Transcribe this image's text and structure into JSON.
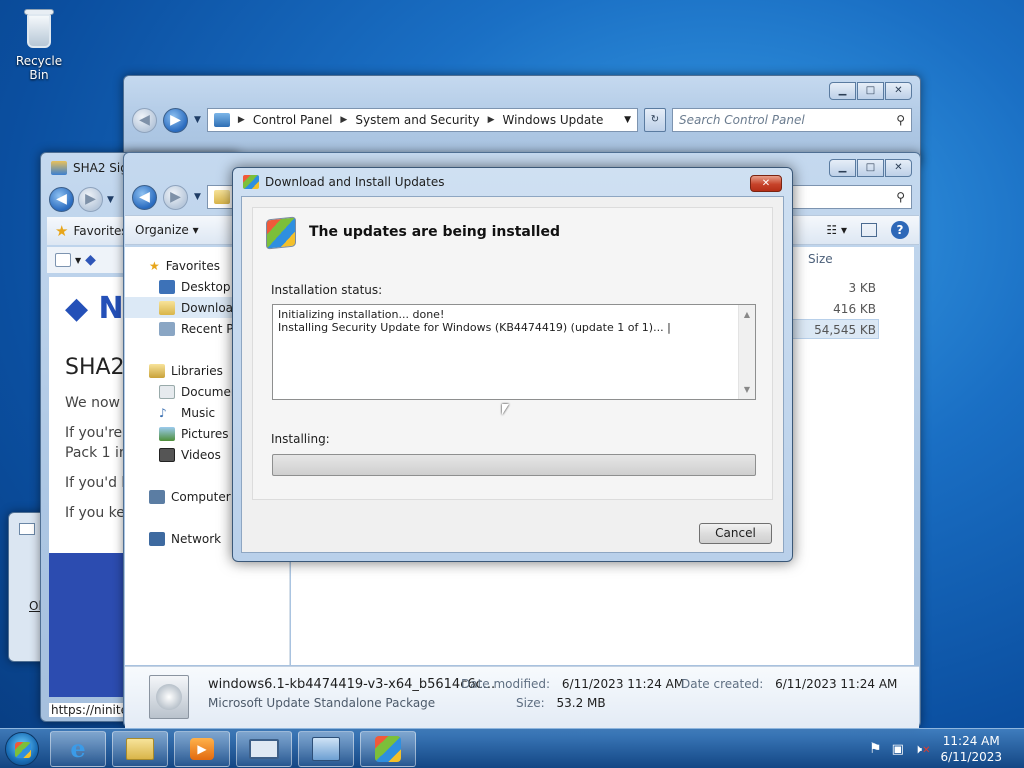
{
  "desktop": {
    "recycle_bin_label": "Recycle Bin"
  },
  "back_window": {
    "breadcrumb": [
      "Control Panel",
      "System and Security",
      "Windows Update"
    ],
    "search_placeholder": "Search Control Panel"
  },
  "browser_window": {
    "tab_title": "SHA2 Sign",
    "favorites_label": "Favorites",
    "page_lines": [
      "SHA2",
      "We now r",
      "If you're u",
      "Pack 1 in",
      "If you'd lik",
      "If you kee"
    ],
    "status_url": "https://ninite."
  },
  "explorer": {
    "organize_label": "Organize",
    "size_header": "Size",
    "sizes": [
      "3 KB",
      "416 KB",
      "54,545 KB"
    ],
    "nav": {
      "favorites": "Favorites",
      "desktop": "Desktop",
      "downloads": "Downloads",
      "recent": "Recent Places",
      "libraries": "Libraries",
      "documents": "Documents",
      "music": "Music",
      "pictures": "Pictures",
      "videos": "Videos",
      "computer": "Computer",
      "network": "Network"
    },
    "details": {
      "filename": "windows6.1-kb4474419-v3-x64_b5614c6c...",
      "filetype": "Microsoft Update Standalone Package",
      "date_modified_label": "Date modified:",
      "date_modified": "6/11/2023 11:24 AM",
      "date_created_label": "Date created:",
      "date_created": "6/11/2023 11:24 AM",
      "size_label": "Size:",
      "size": "53.2 MB"
    }
  },
  "dialog": {
    "title": "Download and Install Updates",
    "heading": "The updates are being installed",
    "status_label": "Installation status:",
    "status_lines": [
      "Initializing installation... done!",
      "Installing Security Update for Windows (KB4474419) (update 1 of 1)..."
    ],
    "installing_label": "Installing:",
    "progress_fraction": 0.0,
    "cancel_label": "Cancel"
  },
  "taskbar": {
    "time": "11:24 AM",
    "date": "6/11/2023"
  },
  "icons": [
    "recycle-bin-icon",
    "shield-icon",
    "ie-icon",
    "folder-icon",
    "media-player-icon",
    "windows-update-icon",
    "flag-icon",
    "network-icon",
    "volume-muted-icon",
    "windows-start-icon"
  ]
}
